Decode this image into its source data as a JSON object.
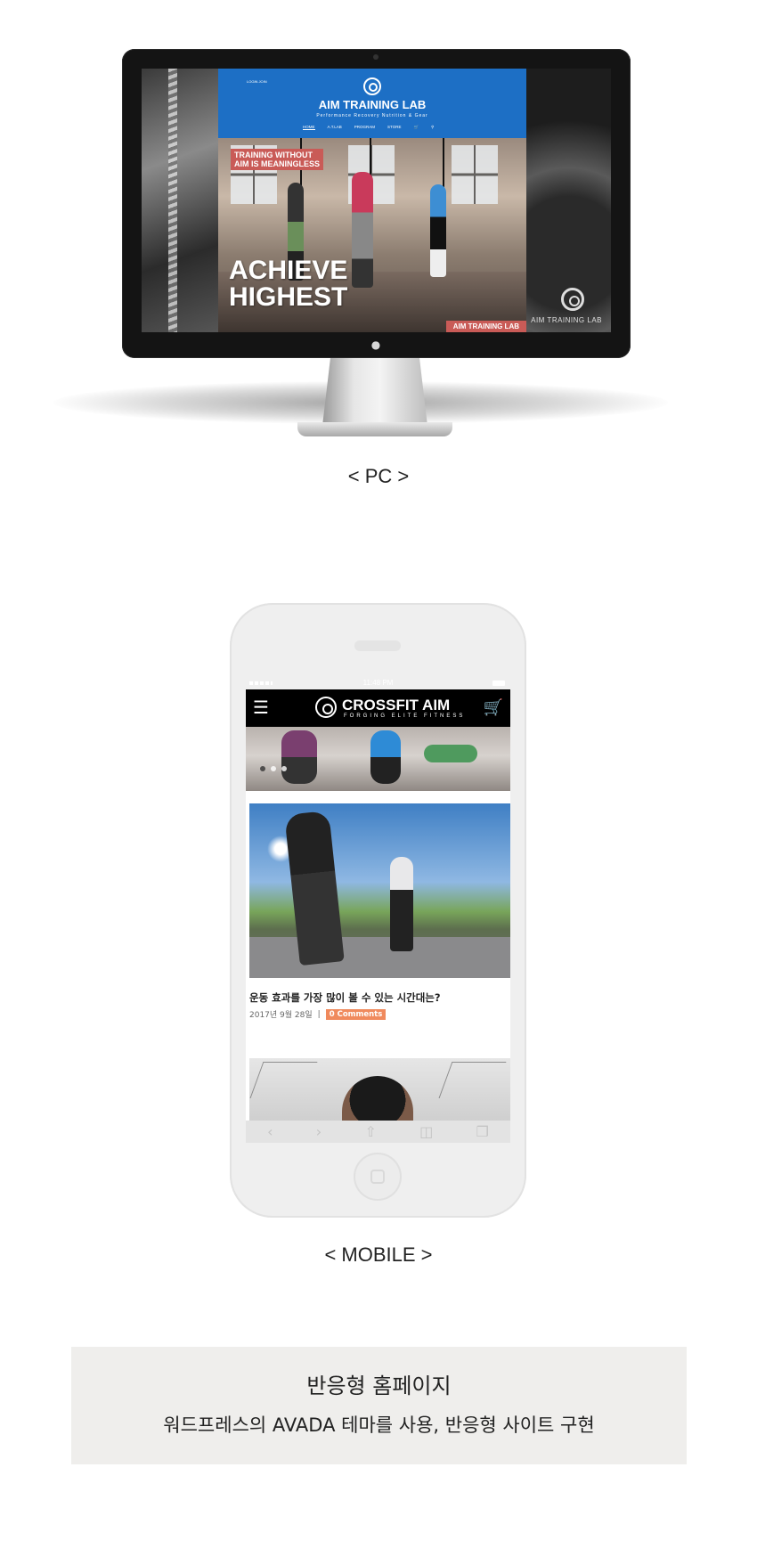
{
  "pc": {
    "caption": "< PC >",
    "site": {
      "top_links": "LOGIN  JOIN",
      "title": "AIM TRAINING LAB",
      "tagline": "Performance  Recovery  Nutrition & Gear",
      "nav": [
        "HOME",
        "A.T.LAB",
        "PROGRAM",
        "STORE"
      ],
      "nav_cart_icon": "cart-icon",
      "nav_search_icon": "search-icon",
      "hero_tag": "TRAINING WITHOUT\nAIM IS MEANINGLESS",
      "hero_headline": "ACHIEVE\nHIGHEST",
      "hero_badge": "AIM TRAINING LAB",
      "right_panel_brand": "AIM TRAINING LAB"
    }
  },
  "mobile": {
    "caption": "< MOBILE >",
    "status_time": "11:48 PM",
    "header": {
      "title": "CROSSFIT AIM",
      "tagline": "FORGING ELITE FITNESS",
      "menu_icon": "hamburger-icon",
      "cart_icon": "cart-icon"
    },
    "post": {
      "title": "운동 효과를 가장 많이 볼 수 있는 시간대는?",
      "date": "2017년 9월 28일",
      "separator": "|",
      "comments": "0 Comments"
    },
    "browser_toolbar": [
      "back-icon",
      "forward-icon",
      "share-icon",
      "bookmarks-icon",
      "tabs-icon"
    ]
  },
  "info": {
    "title": "반응형 홈페이지",
    "description": "워드프레스의 AVADA 테마를 사용, 반응형 사이트 구현"
  },
  "colors": {
    "pc_header_blue": "#1d6fc5",
    "accent_orange": "#f08a2c",
    "hero_tag_red": "#c95b57",
    "comment_badge": "#f08a5d",
    "info_box_bg": "#efeeec"
  }
}
